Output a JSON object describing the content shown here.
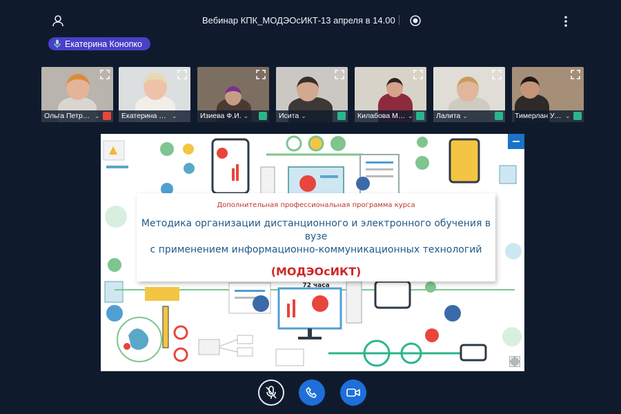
{
  "header": {
    "title": "Вебинар КПК_МОДЭОсИКТ-13 апреля в 14.00",
    "user_icon": "user-icon",
    "record_icon": "record-icon",
    "more_icon": "more-vertical-icon"
  },
  "active_speaker": {
    "name": "Екатерина Конопко",
    "icon": "microphone-icon",
    "color": "#4a3fc7"
  },
  "participants": [
    {
      "name": "Ольга Петро…",
      "status_icon": "mic-muted-icon",
      "status_color": "#e8453c"
    },
    {
      "name": "Екатерина Ко…",
      "status_icon": "none",
      "status_color": ""
    },
    {
      "name": "Изиева Ф.И.",
      "status_icon": "headset-icon",
      "status_color": "#2bb58c"
    },
    {
      "name": "Исита",
      "status_icon": "headset-icon",
      "status_color": "#2bb58c"
    },
    {
      "name": "Килабова Ма…",
      "status_icon": "headset-icon",
      "status_color": "#2bb58c"
    },
    {
      "name": "Лалита",
      "status_icon": "headset-icon",
      "status_color": "#2bb58c"
    },
    {
      "name": "Тимерлан Ус…",
      "status_icon": "headset-icon",
      "status_color": "#2bb58c"
    }
  ],
  "slide": {
    "subtitle": "Дополнительная профессиональная программа курса",
    "title_line1": "Методика организации дистанционного и электронного обучения в вузе",
    "title_line2": "с применением информационно-коммуникационных технологий",
    "abbr": "(МОДЭОсИКТ)",
    "hours": "72 часа"
  },
  "controls": {
    "mic_icon": "mic-off-icon",
    "phone_icon": "phone-icon",
    "camera_icon": "camera-icon",
    "accent": "#1e6fd9"
  }
}
